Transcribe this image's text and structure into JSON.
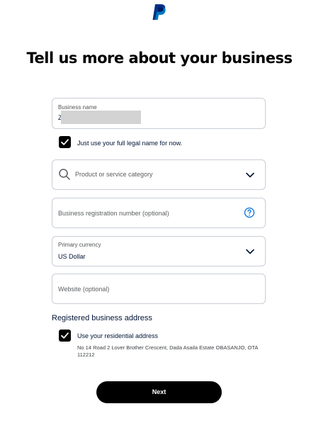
{
  "header": {
    "logo_icon": "paypal-logo-icon"
  },
  "page": {
    "title": "Tell us more about your business"
  },
  "form": {
    "business_name": {
      "label": "Business name",
      "value_visible": "Z"
    },
    "legal_name_checkbox": {
      "label": "Just use your full legal name for now.",
      "checked": true
    },
    "category": {
      "placeholder": "Product or service category",
      "icon": "search-icon"
    },
    "registration_number": {
      "placeholder": "Business registration number (optional)",
      "icon": "question-circle-icon"
    },
    "currency": {
      "label": "Primary currency",
      "value": "US Dollar"
    },
    "website": {
      "placeholder": "Website (optional)"
    }
  },
  "address_section": {
    "title": "Registered business address",
    "residential_checkbox": {
      "label": "Use your residential address",
      "checked": true
    },
    "address_text": "No 14 Road 2 Lover Brother Crescent, Dada Asaila Estate OBASANJO, OTA 112212"
  },
  "actions": {
    "next_label": "Next"
  },
  "colors": {
    "primary": "#000000",
    "help_icon": "#0070e0",
    "border": "#c9ced6"
  }
}
